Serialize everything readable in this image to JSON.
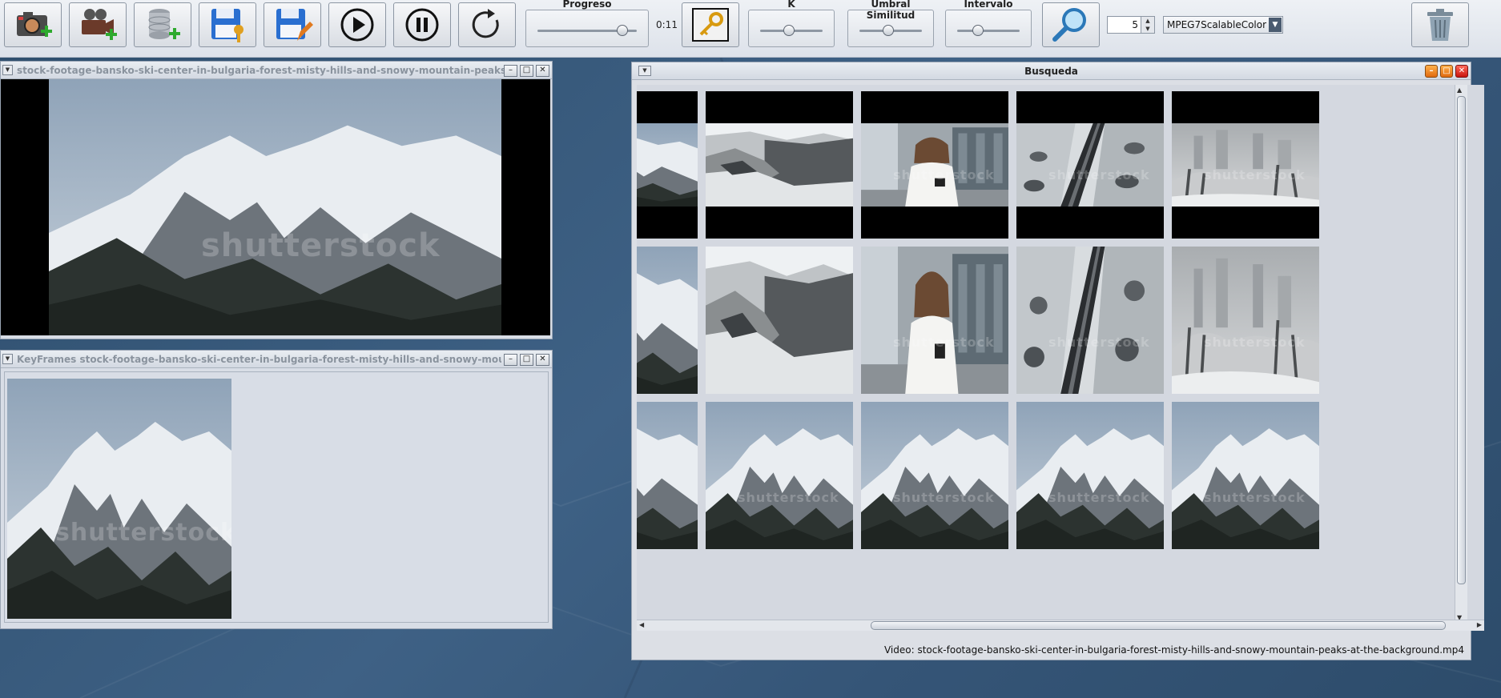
{
  "toolbar": {
    "buttons": [
      {
        "name": "add-image-button",
        "icon": "camera-plus-icon"
      },
      {
        "name": "add-video-button",
        "icon": "video-camera-plus-icon"
      },
      {
        "name": "add-database-button",
        "icon": "database-plus-icon"
      },
      {
        "name": "save-key-button",
        "icon": "floppy-key-icon"
      },
      {
        "name": "save-edit-button",
        "icon": "floppy-pencil-icon"
      },
      {
        "name": "play-button",
        "icon": "play-icon"
      },
      {
        "name": "pause-button",
        "icon": "pause-icon"
      },
      {
        "name": "reset-button",
        "icon": "refresh-icon"
      }
    ],
    "progress_label": "Progreso",
    "progress_value": 0.9,
    "time": "0:11",
    "keyframes_button_icon": "key-icon",
    "k_label": "K",
    "k_value": 0.45,
    "threshold_label": "Umbral Similitud",
    "threshold_value": 0.45,
    "interval_label": "Intervalo",
    "interval_value": 0.3,
    "search_button_icon": "magnifier-icon",
    "spinner_value": "5",
    "descriptor_select": "MPEG7ScalableColor",
    "delete_button_icon": "trash-icon"
  },
  "video_window": {
    "title": "stock-footage-bansko-ski-center-in-bulgaria-forest-misty-hills-and-snowy-mountain-peaks-at-the-backgr...",
    "watermark": "shutterstock"
  },
  "keyframes_window": {
    "title": "KeyFrames stock-footage-bansko-ski-center-in-bulgaria-forest-misty-hills-and-snowy-mountain-peaks-at...",
    "watermark": "shutterstock"
  },
  "search_window": {
    "title": "Busqueda",
    "watermark": "shutterstock",
    "status": "Video: stock-footage-bansko-ski-center-in-bulgaria-forest-misty-hills-and-snowy-mountain-peaks-at-the-background.mp4",
    "rows": [
      [
        "mountain-peak",
        "rocky-snow-cliff",
        "woman-phone",
        "aerial-snow-highway",
        "foggy-city-park"
      ],
      [
        "mountain-peak",
        "rocky-snow-cliff",
        "woman-phone",
        "aerial-snow-highway",
        "foggy-city-park"
      ],
      [
        "mountain-peak",
        "mountain-peak",
        "mountain-peak",
        "mountain-peak",
        "mountain-peak"
      ]
    ]
  }
}
